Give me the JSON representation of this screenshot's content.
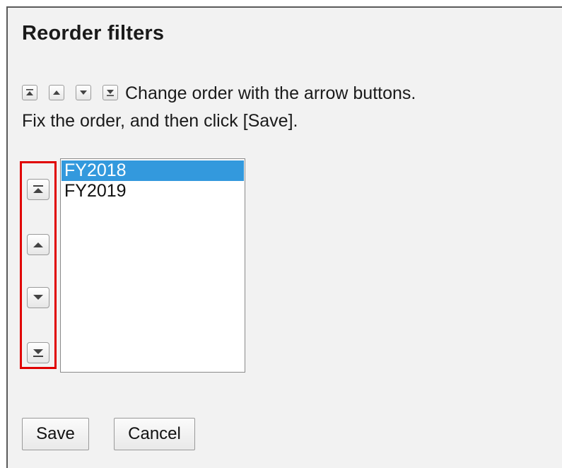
{
  "title": "Reorder filters",
  "instructions": {
    "line1": "Change order with the arrow buttons.",
    "line2": "Fix the order, and then click [Save]."
  },
  "icons": {
    "move_top": "move-to-top-icon",
    "move_up": "move-up-icon",
    "move_down": "move-down-icon",
    "move_bottom": "move-to-bottom-icon"
  },
  "filters": {
    "items": [
      {
        "label": "FY2018",
        "selected": true
      },
      {
        "label": "FY2019",
        "selected": false
      }
    ]
  },
  "buttons": {
    "save": "Save",
    "cancel": "Cancel"
  },
  "colors": {
    "selection": "#3399dd",
    "highlight_border": "#e00000",
    "panel_background": "#f2f2f2"
  }
}
